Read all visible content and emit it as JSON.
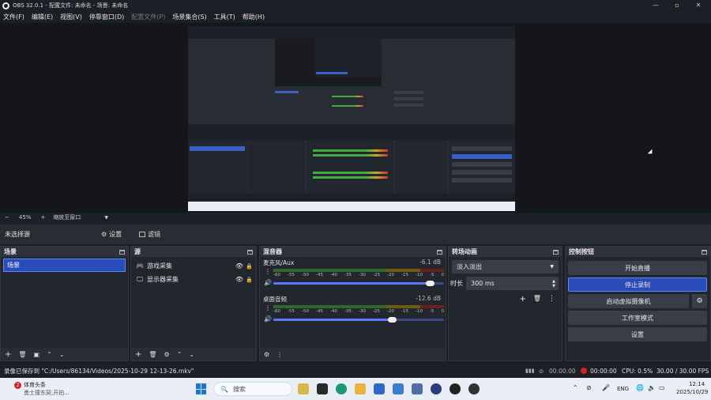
{
  "window": {
    "title": "OBS 32.0.1 - 配置文件: 未命名 - 场景: 未命名",
    "controls": [
      "—",
      "▫",
      "✕"
    ]
  },
  "menu": [
    {
      "label": "文件(F)",
      "enabled": true
    },
    {
      "label": "编辑(E)",
      "enabled": true
    },
    {
      "label": "视图(V)",
      "enabled": true
    },
    {
      "label": "停靠窗口(D)",
      "enabled": true
    },
    {
      "label": "配置文件(P)",
      "enabled": false
    },
    {
      "label": "场景集合(S)",
      "enabled": true
    },
    {
      "label": "工具(T)",
      "enabled": true
    },
    {
      "label": "帮助(H)",
      "enabled": true
    }
  ],
  "zoom": {
    "minus": "−",
    "value": "45%",
    "plus": "+",
    "mode": "缩放至窗口"
  },
  "context": {
    "selection": "未选择源",
    "settings_label": "设置",
    "filters_label": "滤镜"
  },
  "scenes": {
    "title": "场景",
    "items": [
      "场景"
    ]
  },
  "sources": {
    "title": "源",
    "items": [
      {
        "label": "游戏采集",
        "icon": "gamepad-icon"
      },
      {
        "label": "显示器采集",
        "icon": "monitor-icon"
      }
    ]
  },
  "mixer": {
    "title": "混音器",
    "ticks": [
      "-60",
      "-55",
      "-50",
      "-45",
      "-40",
      "-35",
      "-30",
      "-25",
      "-20",
      "-15",
      "-10",
      "-5",
      "0"
    ],
    "channels": [
      {
        "name": "麦克风/Aux",
        "db": "-6.1 dB",
        "level": 0.92
      },
      {
        "name": "桌面音频",
        "db": "-12.6 dB",
        "level": 0.7
      }
    ]
  },
  "transitions": {
    "title": "转场动画",
    "selected": "淡入淡出",
    "duration_label": "时长",
    "duration_value": "300 ms"
  },
  "controls": {
    "title": "控制按钮",
    "buttons": [
      "开始直播",
      "停止录制",
      "启动虚拟摄像机",
      "工作室模式",
      "设置"
    ]
  },
  "status": {
    "message": "录像已保存到 \"C:/Users/86134/Videos/2025-10-29 12-13-26.mkv\"",
    "stream_time": "00:00:00",
    "record_time": "00:00:00",
    "cpu": "CPU: 0.5%",
    "fps": "30.00 / 30.00 FPS"
  },
  "taskbar": {
    "news_badge": "2",
    "news_title": "体育头条",
    "news_sub": "勇士撞东契,开拍...",
    "search_placeholder": "搜索",
    "lang": "ENG",
    "time": "12:14",
    "date": "2025/10/29"
  },
  "colors": {
    "accent": "#284cb8",
    "background": "#1d1f26",
    "dock": "#24262d",
    "record_dot": "#e02020"
  }
}
